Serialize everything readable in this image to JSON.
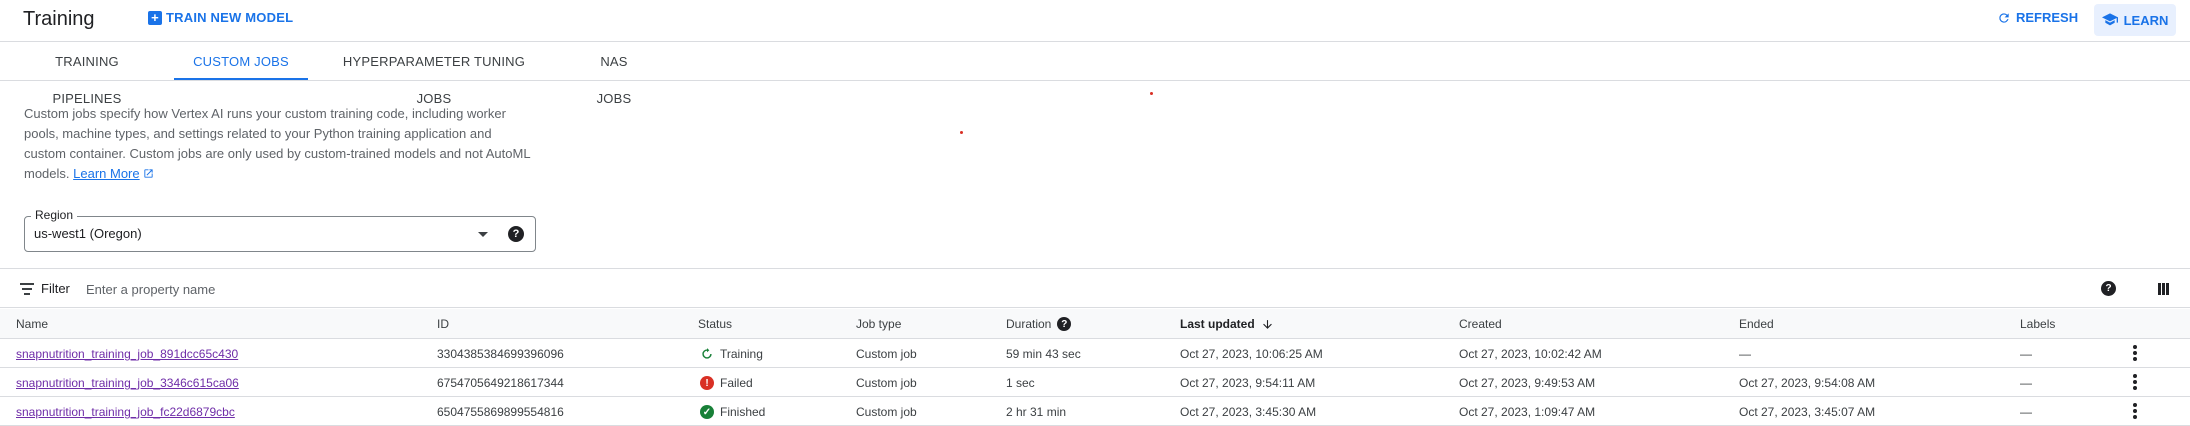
{
  "header": {
    "title": "Training",
    "train_new_model": "TRAIN NEW MODEL",
    "refresh": "REFRESH",
    "learn": "LEARN",
    "accent_color": "#1a73e8"
  },
  "tabs": [
    {
      "label": "TRAINING PIPELINES",
      "active": false
    },
    {
      "label": "CUSTOM JOBS",
      "active": true
    },
    {
      "label": "HYPERPARAMETER TUNING JOBS",
      "active": false
    },
    {
      "label": "NAS JOBS",
      "active": false
    }
  ],
  "description": {
    "line1": "Custom jobs specify how Vertex AI runs your custom training code, including worker",
    "line2": "pools, machine types, and settings related to your Python training application and",
    "line3": "custom container. Custom jobs are only used by custom-trained models and not AutoML",
    "line4_prefix": "models. ",
    "learn_more": "Learn More"
  },
  "region": {
    "label": "Region",
    "value": "us-west1 (Oregon)"
  },
  "filter": {
    "label": "Filter",
    "placeholder": "Enter a property name"
  },
  "table": {
    "columns": {
      "name": "Name",
      "id": "ID",
      "status": "Status",
      "job_type": "Job type",
      "duration": "Duration",
      "last_updated": "Last updated",
      "created": "Created",
      "ended": "Ended",
      "labels": "Labels"
    },
    "rows": [
      {
        "name": "snapnutrition_training_job_891dcc65c430",
        "id": "3304385384699396096",
        "status": "Training",
        "status_icon": "spinner-icon",
        "status_color": "#188038",
        "job_type": "Custom job",
        "duration": "59 min 43 sec",
        "last_updated": "Oct 27, 2023, 10:06:25 AM",
        "created": "Oct 27, 2023, 10:02:42 AM",
        "ended": "—",
        "labels": "—"
      },
      {
        "name": "snapnutrition_training_job_3346c615ca06",
        "id": "6754705649218617344",
        "status": "Failed",
        "status_icon": "error-icon",
        "status_color": "#d93025",
        "job_type": "Custom job",
        "duration": "1 sec",
        "last_updated": "Oct 27, 2023, 9:54:11 AM",
        "created": "Oct 27, 2023, 9:49:53 AM",
        "ended": "Oct 27, 2023, 9:54:08 AM",
        "labels": "—"
      },
      {
        "name": "snapnutrition_training_job_fc22d6879cbc",
        "id": "6504755869899554816",
        "status": "Finished",
        "status_icon": "check-circle-icon",
        "status_color": "#188038",
        "job_type": "Custom job",
        "duration": "2 hr 31 min",
        "last_updated": "Oct 27, 2023, 3:45:30 AM",
        "created": "Oct 27, 2023, 1:09:47 AM",
        "ended": "Oct 27, 2023, 3:45:07 AM",
        "labels": "—"
      }
    ]
  }
}
